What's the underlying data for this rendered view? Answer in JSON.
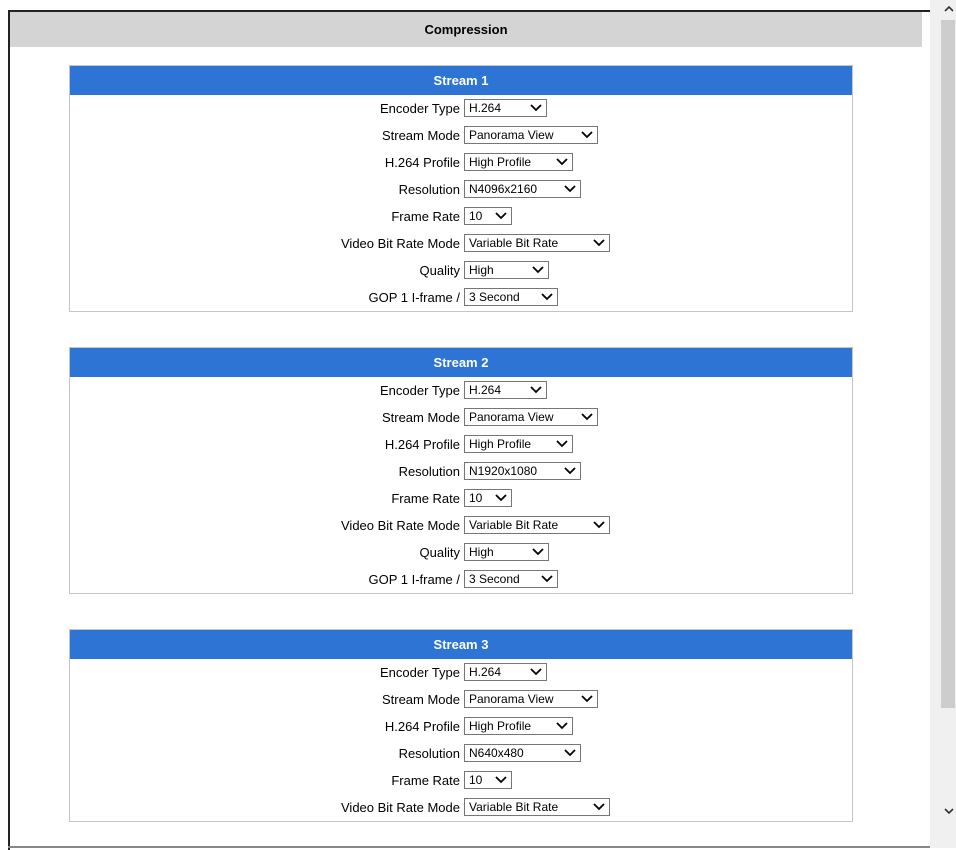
{
  "header": {
    "title": "Compression"
  },
  "streams": [
    {
      "title": "Stream 1",
      "rows": [
        {
          "label": "Encoder Type",
          "value": "H.264"
        },
        {
          "label": "Stream Mode",
          "value": "Panorama View"
        },
        {
          "label": "H.264 Profile",
          "value": "High Profile"
        },
        {
          "label": "Resolution",
          "value": "N4096x2160"
        },
        {
          "label": "Frame Rate",
          "value": "10"
        },
        {
          "label": "Video Bit Rate Mode",
          "value": "Variable Bit Rate"
        },
        {
          "label": "Quality",
          "value": "High"
        },
        {
          "label": "GOP 1 I-frame /",
          "value": "3 Second"
        }
      ]
    },
    {
      "title": "Stream 2",
      "rows": [
        {
          "label": "Encoder Type",
          "value": "H.264"
        },
        {
          "label": "Stream Mode",
          "value": "Panorama View"
        },
        {
          "label": "H.264 Profile",
          "value": "High Profile"
        },
        {
          "label": "Resolution",
          "value": "N1920x1080"
        },
        {
          "label": "Frame Rate",
          "value": "10"
        },
        {
          "label": "Video Bit Rate Mode",
          "value": "Variable Bit Rate"
        },
        {
          "label": "Quality",
          "value": "High"
        },
        {
          "label": "GOP 1 I-frame /",
          "value": "3 Second"
        }
      ]
    },
    {
      "title": "Stream 3",
      "rows": [
        {
          "label": "Encoder Type",
          "value": "H.264"
        },
        {
          "label": "Stream Mode",
          "value": "Panorama View"
        },
        {
          "label": "H.264 Profile",
          "value": "High Profile"
        },
        {
          "label": "Resolution",
          "value": "N640x480"
        },
        {
          "label": "Frame Rate",
          "value": "10"
        },
        {
          "label": "Video Bit Rate Mode",
          "value": "Variable Bit Rate"
        }
      ]
    }
  ],
  "colors": {
    "header_bg": "#d4d4d4",
    "stream_title_bg": "#2d74d4",
    "stream_title_text": "#ffffff"
  },
  "icons": {
    "dropdown": "chevron-down-icon",
    "scroll_up": "chevron-up-icon",
    "scroll_down": "chevron-down-icon"
  }
}
